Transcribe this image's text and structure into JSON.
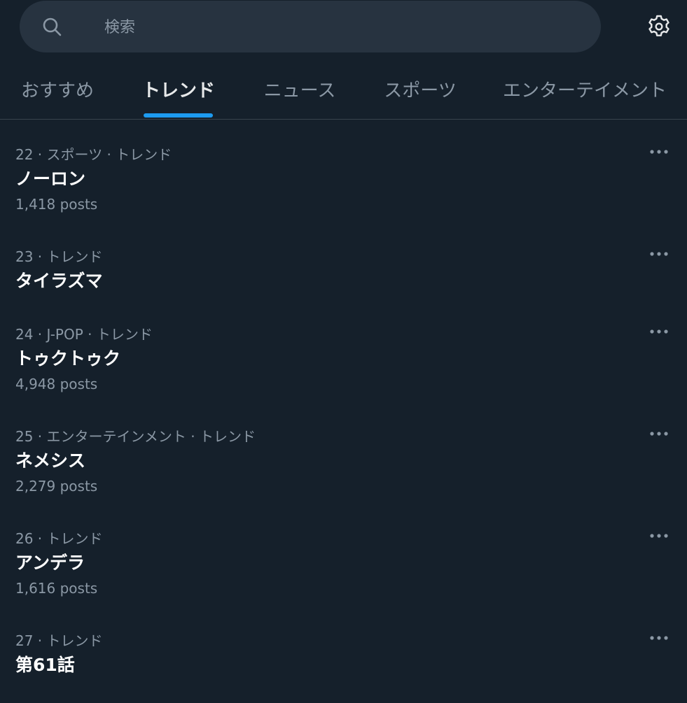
{
  "search": {
    "placeholder": "検索"
  },
  "icons": {
    "search": "search-icon",
    "settings": "gear-icon",
    "more": "more-icon"
  },
  "colors": {
    "background": "#15202b",
    "search_bg": "#273340",
    "accent": "#1d9bf0",
    "text_primary": "#e7e9ea",
    "text_secondary": "#8b98a5"
  },
  "tabs": [
    {
      "label": "おすすめ",
      "active": false
    },
    {
      "label": "トレンド",
      "active": true
    },
    {
      "label": "ニュース",
      "active": false
    },
    {
      "label": "スポーツ",
      "active": false
    },
    {
      "label": "エンターテイメント",
      "active": false
    }
  ],
  "trends": [
    {
      "meta": "22 · スポーツ · トレンド",
      "name": "ノーロン",
      "count": "1,418 posts"
    },
    {
      "meta": "23 · トレンド",
      "name": "タイラズマ",
      "count": ""
    },
    {
      "meta": "24 · J-POP · トレンド",
      "name": "トゥクトゥク",
      "count": "4,948 posts"
    },
    {
      "meta": "25 · エンターテインメント · トレンド",
      "name": "ネメシス",
      "count": "2,279 posts"
    },
    {
      "meta": "26 · トレンド",
      "name": "アンデラ",
      "count": "1,616 posts"
    },
    {
      "meta": "27 · トレンド",
      "name": "第61話",
      "count": ""
    }
  ]
}
